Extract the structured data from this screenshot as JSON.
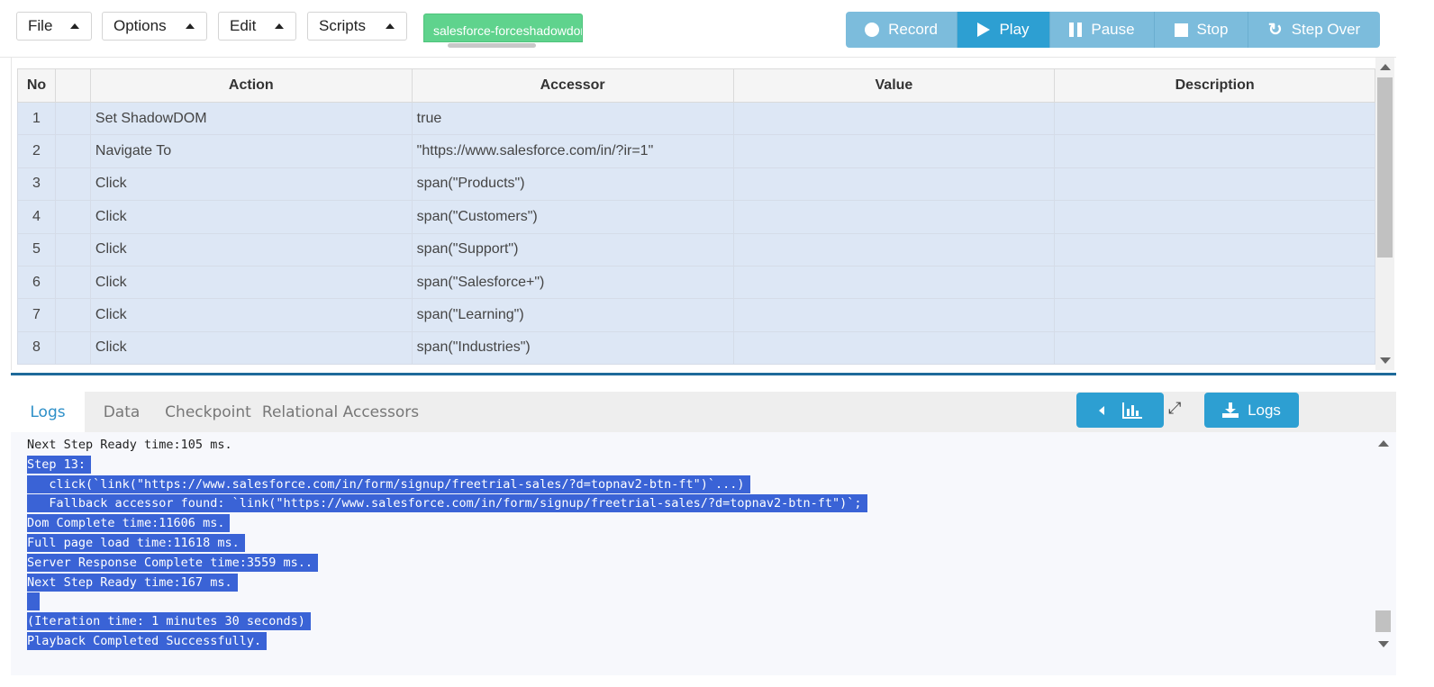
{
  "menu": {
    "file": "File",
    "options": "Options",
    "edit": "Edit",
    "scripts": "Scripts"
  },
  "script_tab": "salesforce-forceshadowdom",
  "playback": {
    "record": "Record",
    "play": "Play",
    "pause": "Pause",
    "stop": "Stop",
    "step_over": "Step Over"
  },
  "table": {
    "headers": [
      "No",
      "",
      "Action",
      "Accessor",
      "Value",
      "Description"
    ],
    "rows": [
      {
        "no": "1",
        "action": "Set ShadowDOM",
        "accessor": "true",
        "value": "",
        "description": ""
      },
      {
        "no": "2",
        "action": "Navigate To",
        "accessor": "\"https://www.salesforce.com/in/?ir=1\"",
        "value": "",
        "description": ""
      },
      {
        "no": "3",
        "action": "Click",
        "accessor": "span(\"Products\")",
        "value": "",
        "description": ""
      },
      {
        "no": "4",
        "action": "Click",
        "accessor": "span(\"Customers\")",
        "value": "",
        "description": ""
      },
      {
        "no": "5",
        "action": "Click",
        "accessor": "span(\"Support\")",
        "value": "",
        "description": ""
      },
      {
        "no": "6",
        "action": "Click",
        "accessor": "span(\"Salesforce+\")",
        "value": "",
        "description": ""
      },
      {
        "no": "7",
        "action": "Click",
        "accessor": "span(\"Learning\")",
        "value": "",
        "description": ""
      },
      {
        "no": "8",
        "action": "Click",
        "accessor": "span(\"Industries\")",
        "value": "",
        "description": ""
      }
    ]
  },
  "tabs": [
    "Logs",
    "Data",
    "Checkpoint",
    "Relational Accessors"
  ],
  "logs_button": "Logs",
  "log_lines": [
    {
      "text": "Next Step Ready time:105 ms.",
      "selected": false
    },
    {
      "text": "Step 13:",
      "selected": true
    },
    {
      "text": "   click(`link(\"https://www.salesforce.com/in/form/signup/freetrial-sales/?d=topnav2-btn-ft\")`...)",
      "selected": true
    },
    {
      "text": "   Fallback accessor found: `link(\"https://www.salesforce.com/in/form/signup/freetrial-sales/?d=topnav2-btn-ft\")`;",
      "selected": true
    },
    {
      "text": "Dom Complete time:11606 ms.",
      "selected": true
    },
    {
      "text": "Full page load time:11618 ms.",
      "selected": true
    },
    {
      "text": "Server Response Complete time:3559 ms..",
      "selected": true
    },
    {
      "text": "Next Step Ready time:167 ms.",
      "selected": true
    },
    {
      "text": " ",
      "selected": true
    },
    {
      "text": "(Iteration time: 1 minutes 30 seconds)",
      "selected": true
    },
    {
      "text": "Playback Completed Successfully.",
      "selected": true
    }
  ]
}
